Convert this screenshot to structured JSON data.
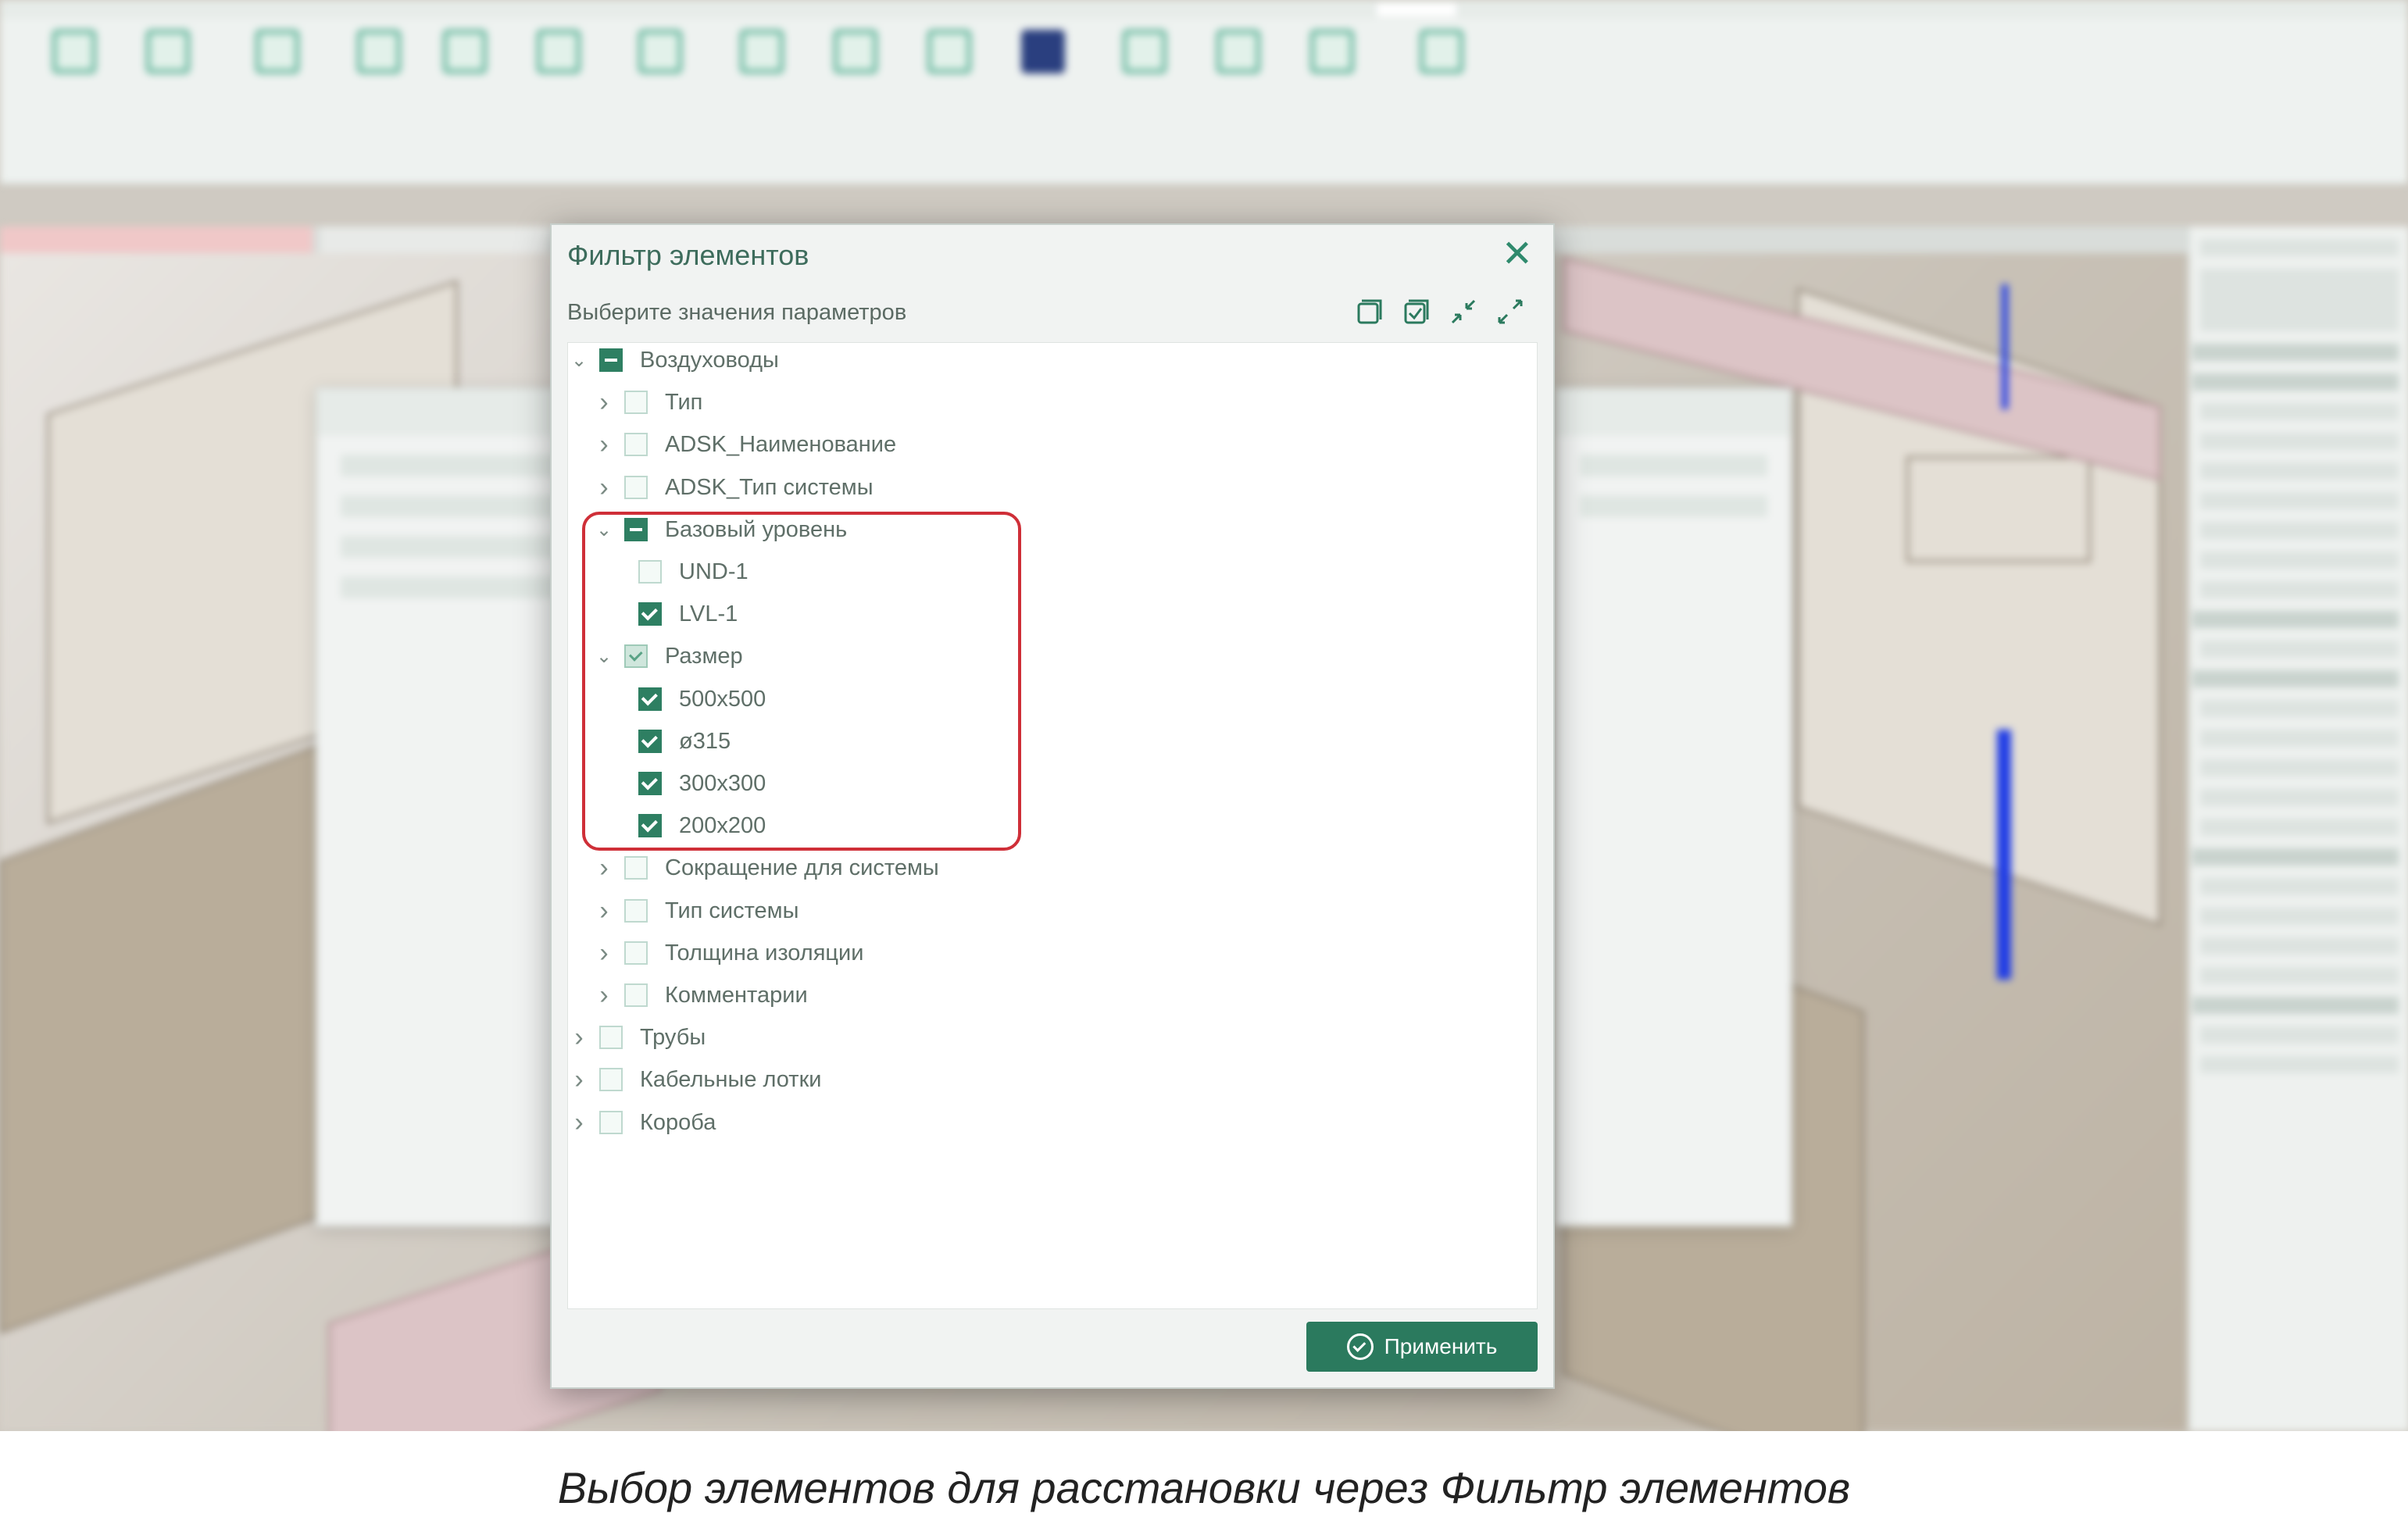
{
  "dialog": {
    "title": "Фильтр элементов",
    "subtitle": "Выберите значения параметров",
    "apply_label": "Применить",
    "tree": [
      {
        "label": "Воздуховоды",
        "state": "partial",
        "expanded": true,
        "level": 0
      },
      {
        "label": "Тип",
        "state": "unchecked",
        "expanded": false,
        "level": 1
      },
      {
        "label": "ADSK_Наименование",
        "state": "unchecked",
        "expanded": false,
        "level": 1
      },
      {
        "label": "ADSK_Тип системы",
        "state": "unchecked",
        "expanded": false,
        "level": 1
      },
      {
        "label": "Базовый уровень",
        "state": "partial",
        "expanded": true,
        "level": 1
      },
      {
        "label": "UND-1",
        "state": "unchecked",
        "level": 2
      },
      {
        "label": "LVL-1",
        "state": "checked",
        "level": 2
      },
      {
        "label": "Размер",
        "state": "mixed",
        "expanded": true,
        "level": 1
      },
      {
        "label": "500x500",
        "state": "checked",
        "level": 2
      },
      {
        "label": "ø315",
        "state": "checked",
        "level": 2
      },
      {
        "label": "300x300",
        "state": "checked",
        "level": 2
      },
      {
        "label": "200x200",
        "state": "checked",
        "level": 2
      },
      {
        "label": "Сокращение для системы",
        "state": "unchecked",
        "expanded": false,
        "level": 1
      },
      {
        "label": "Тип системы",
        "state": "unchecked",
        "expanded": false,
        "level": 1
      },
      {
        "label": "Толщина изоляции",
        "state": "unchecked",
        "expanded": false,
        "level": 1
      },
      {
        "label": "Комментарии",
        "state": "unchecked",
        "expanded": false,
        "level": 1
      },
      {
        "label": "Трубы",
        "state": "unchecked",
        "expanded": false,
        "level": 0
      },
      {
        "label": "Кабельные лотки",
        "state": "unchecked",
        "expanded": false,
        "level": 0
      },
      {
        "label": "Короба",
        "state": "unchecked",
        "expanded": false,
        "level": 0
      }
    ]
  },
  "caption": "Выбор элементов для расстановки через Фильтр элементов",
  "colors": {
    "accent": "#2b7a5e",
    "highlight": "#cf2f38"
  }
}
